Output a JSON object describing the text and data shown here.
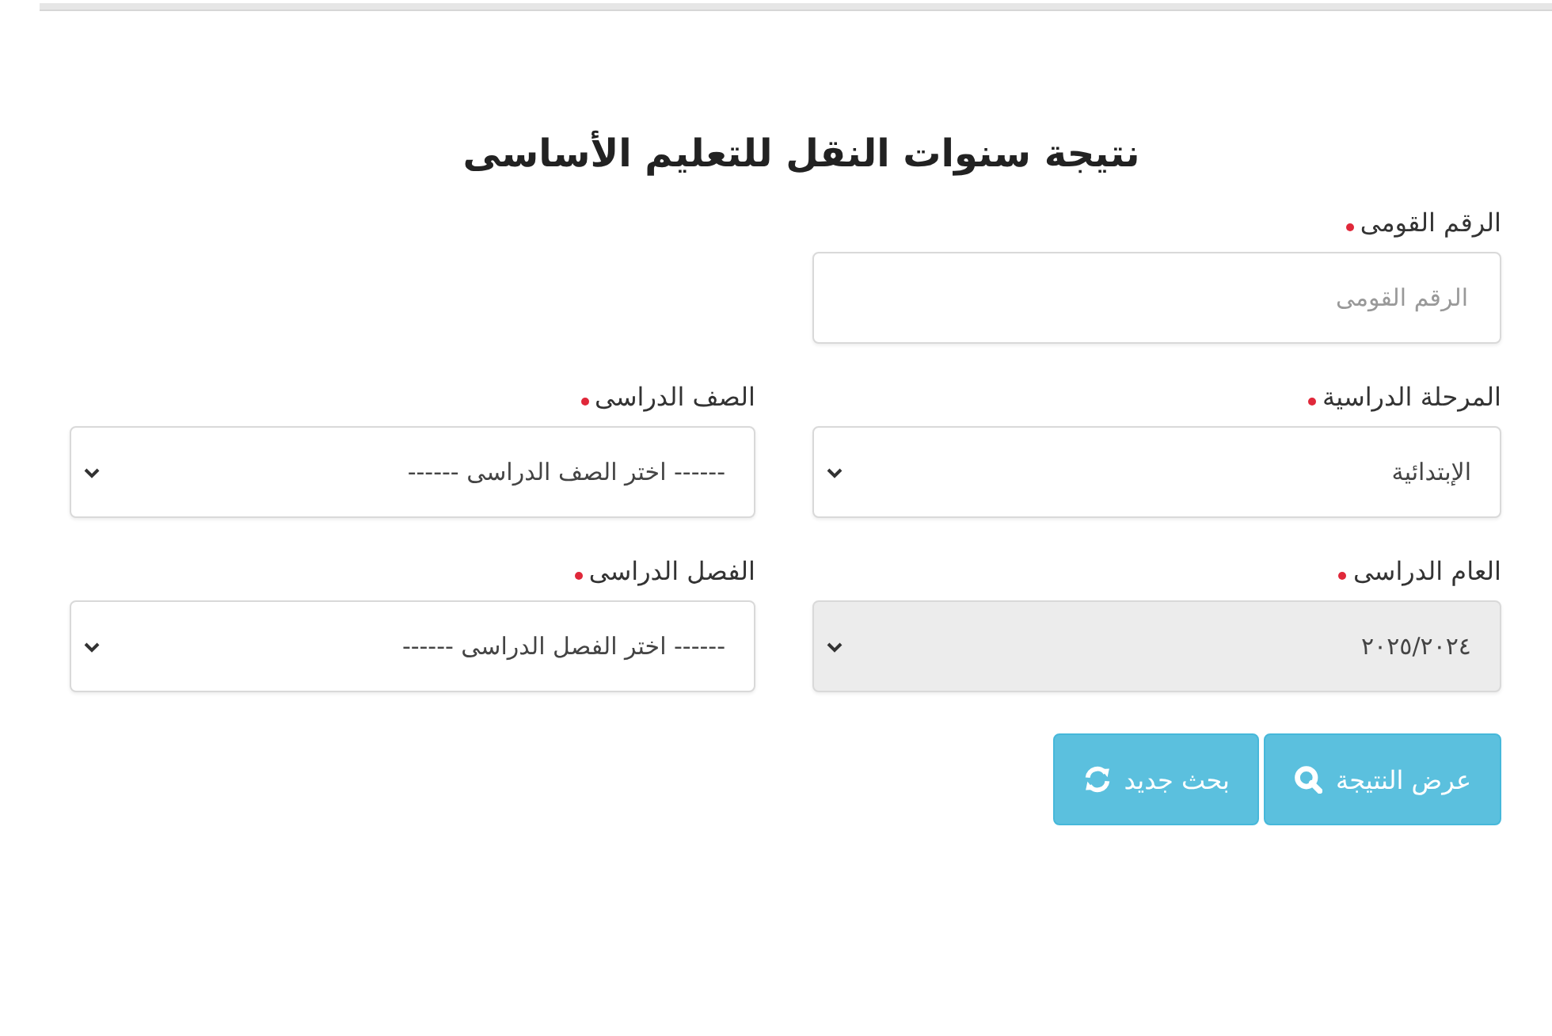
{
  "title": "نتيجة سنوات النقل للتعليم الأساسى",
  "national_id": {
    "label": "الرقم القومى",
    "required": true,
    "placeholder": "الرقم القومى"
  },
  "selects": [
    {
      "label": "المرحلة الدراسية",
      "required": true,
      "value": "الإبتدائية",
      "disabled": false
    },
    {
      "label": "الصف الدراسى",
      "required": true,
      "value": "------ اختر الصف الدراسى ------",
      "disabled": false
    },
    {
      "label": "العام الدراسى",
      "required": true,
      "value": "٢٠٢٥/٢٠٢٤",
      "disabled": true
    },
    {
      "label": "الفصل الدراسى",
      "required": true,
      "value": "------ اختر الفصل الدراسى ------",
      "disabled": false
    }
  ],
  "buttons": [
    {
      "label": "عرض النتيجة",
      "kind": "search"
    },
    {
      "label": "بحث جديد",
      "kind": "reset"
    }
  ]
}
